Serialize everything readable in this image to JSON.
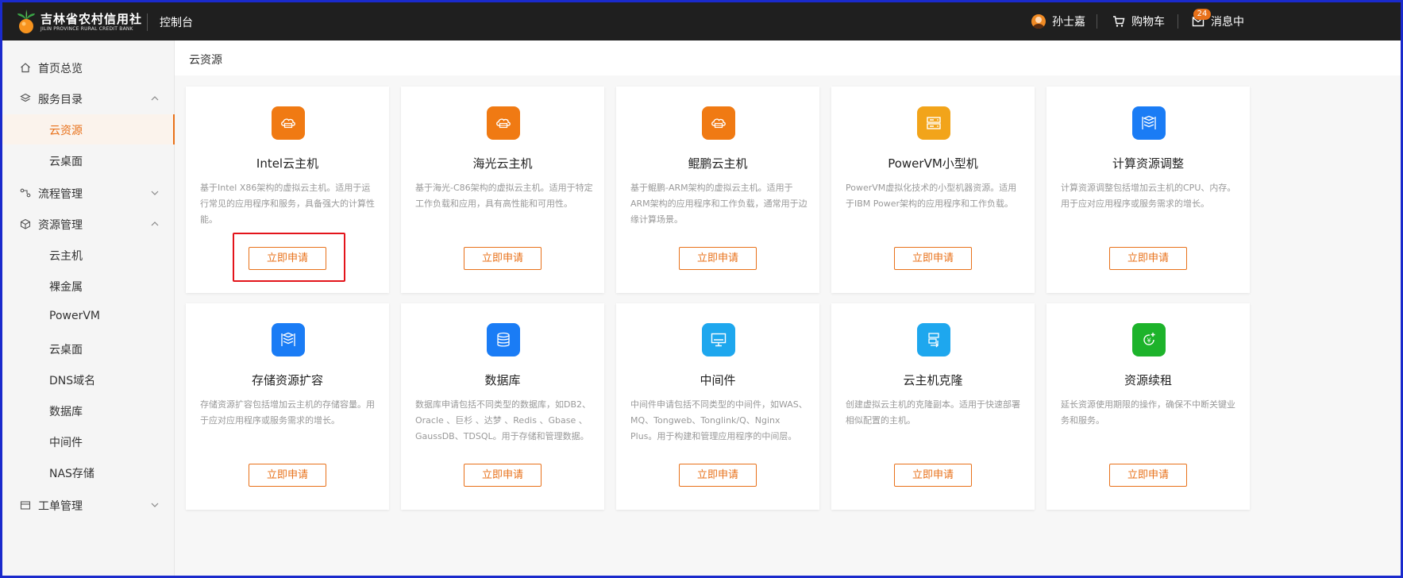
{
  "header": {
    "logo_title": "吉林省农村信用社",
    "logo_subtitle": "JILIN PROVINCE RURAL CREDIT BANK",
    "console_label": "控制台",
    "user_name": "孙士嘉",
    "cart_label": "购物车",
    "message_label": "消息中",
    "message_count": "24"
  },
  "sidebar": {
    "items": [
      {
        "label": "首页总览",
        "icon": "home-icon"
      },
      {
        "label": "服务目录",
        "icon": "layers-icon"
      },
      {
        "label": "云资源",
        "sub": true,
        "active": true
      },
      {
        "label": "云桌面",
        "sub": true
      },
      {
        "label": "流程管理",
        "icon": "flow-icon"
      },
      {
        "label": "资源管理",
        "icon": "resource-icon"
      },
      {
        "label": "云主机",
        "sub": true
      },
      {
        "label": "裸金属",
        "sub": true
      },
      {
        "label": "PowerVM",
        "sub": true
      },
      {
        "label": "云桌面",
        "sub": true
      },
      {
        "label": "DNS域名",
        "sub": true
      },
      {
        "label": "数据库",
        "sub": true
      },
      {
        "label": "中间件",
        "sub": true
      },
      {
        "label": "NAS存储",
        "sub": true
      },
      {
        "label": "工单管理",
        "icon": "ticket-icon"
      }
    ]
  },
  "breadcrumb": "云资源",
  "cards": [
    {
      "title": "Intel云主机",
      "desc": "基于Intel X86架构的虚拟云主机。适用于运行常见的应用程序和服务，具备强大的计算性能。",
      "button": "立即申请",
      "icon": "cloud-server-icon",
      "color": "#f07a13"
    },
    {
      "title": "海光云主机",
      "desc": "基于海光-C86架构的虚拟云主机。适用于特定工作负载和应用，具有高性能和可用性。",
      "button": "立即申请",
      "icon": "cloud-server-icon",
      "color": "#f07a13"
    },
    {
      "title": "鲲鹏云主机",
      "desc": "基于鲲鹏-ARM架构的虚拟云主机。适用于ARM架构的应用程序和工作负载，通常用于边缘计算场景。",
      "button": "立即申请",
      "icon": "cloud-server-icon",
      "color": "#f07a13"
    },
    {
      "title": "PowerVM小型机",
      "desc": "PowerVM虚拟化技术的小型机器资源。适用于IBM Power架构的应用程序和工作负载。",
      "button": "立即申请",
      "icon": "minicomputer-icon",
      "color": "#f2a41a"
    },
    {
      "title": "计算资源调整",
      "desc": "计算资源调整包括增加云主机的CPU、内存。用于应对应用程序或服务需求的增长。",
      "button": "立即申请",
      "icon": "compute-adjust-icon",
      "color": "#1a7cf5"
    },
    {
      "title": "存储资源扩容",
      "desc": "存储资源扩容包括增加云主机的存储容量。用于应对应用程序或服务需求的增长。",
      "button": "立即申请",
      "icon": "storage-expand-icon",
      "color": "#1a7cf5"
    },
    {
      "title": "数据库",
      "desc": "数据库申请包括不同类型的数据库，如DB2、Oracle 、巨杉 、达梦 、Redis 、Gbase 、GaussDB、TDSQL。用于存储和管理数据。",
      "button": "立即申请",
      "icon": "database-icon",
      "color": "#1a7cf5"
    },
    {
      "title": "中间件",
      "desc": "中间件申请包括不同类型的中间件，如WAS、MQ、Tongweb、Tonglink/Q、Nginx Plus。用于构建和管理应用程序的中间层。",
      "button": "立即申请",
      "icon": "monitor-icon",
      "color": "#1ea7ee"
    },
    {
      "title": "云主机克隆",
      "desc": "创建虚拟云主机的克隆副本。适用于快速部署相似配置的主机。",
      "button": "立即申请",
      "icon": "clone-icon",
      "color": "#1ea7ee"
    },
    {
      "title": "资源续租",
      "desc": "延长资源使用期限的操作，确保不中断关键业务和服务。",
      "button": "立即申请",
      "icon": "renew-icon",
      "color": "#1db32b"
    }
  ]
}
